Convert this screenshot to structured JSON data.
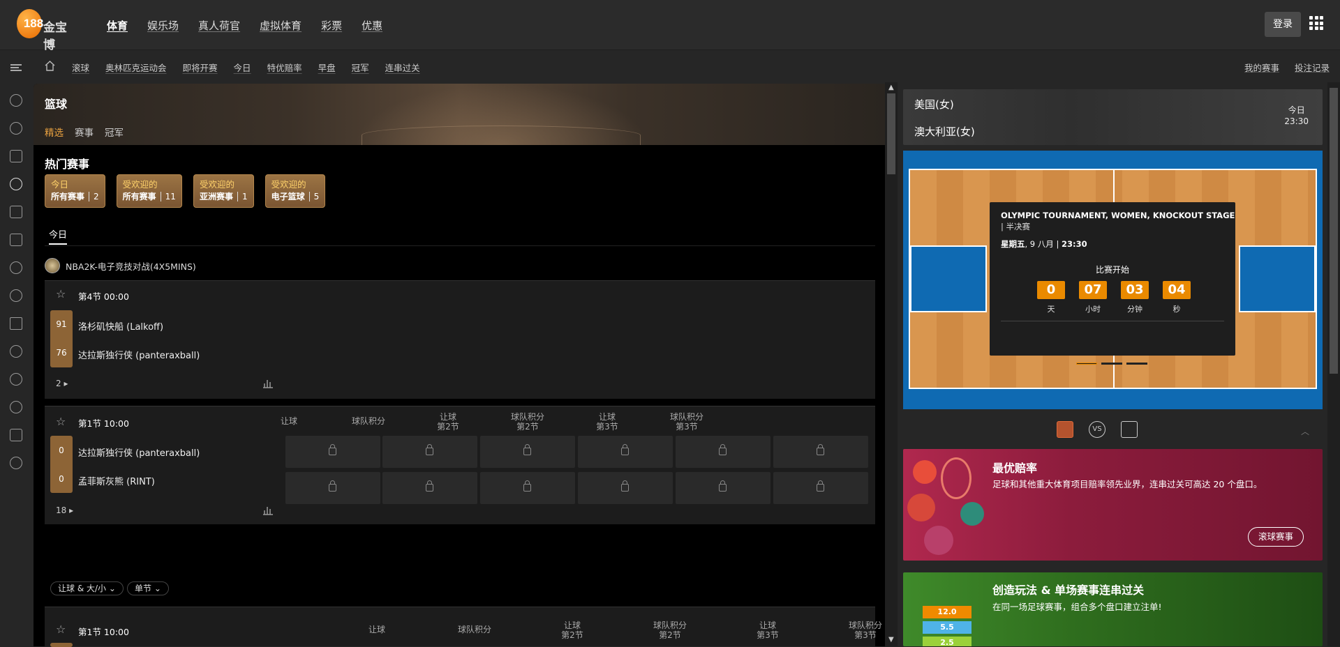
{
  "header": {
    "logo_text": "金宝博",
    "logo_mark": "188",
    "nav": [
      "体育",
      "娱乐场",
      "真人荷官",
      "虚拟体育",
      "彩票",
      "优惠"
    ],
    "login": "登录"
  },
  "subnav": {
    "items": [
      "滚球",
      "奥林匹克运动会",
      "即将开赛",
      "今日",
      "特优赔率",
      "早盘",
      "冠军",
      "连串过关"
    ],
    "my_events": "我的赛事",
    "bet_record": "投注记录"
  },
  "page": {
    "sport_title": "篮球",
    "tabs": [
      "精选",
      "赛事",
      "冠军"
    ],
    "hot_title": "热门赛事",
    "chips": [
      {
        "top": "今日",
        "bottom": "所有赛事",
        "count": "2"
      },
      {
        "top": "受欢迎的",
        "bottom": "所有赛事",
        "count": "11"
      },
      {
        "top": "受欢迎的",
        "bottom": "亚洲赛事",
        "count": "1"
      },
      {
        "top": "受欢迎的",
        "bottom": "电子篮球",
        "count": "5"
      }
    ],
    "today_tab": "今日",
    "league": "NBA2K-电子竞技对战(4X5MINS)"
  },
  "match1": {
    "period": "第4节 00:00",
    "home_score": "91",
    "home_team": "洛杉矶快船 (Lalkoff)",
    "away_score": "76",
    "away_team": "达拉斯独行侠 (panteraxball)",
    "more_count": "2"
  },
  "match2": {
    "period": "第1节 10:00",
    "home_score": "0",
    "home_team": "达拉斯独行侠 (panteraxball)",
    "away_score": "0",
    "away_team": "孟菲斯灰熊 (RINT)",
    "more_count": "18",
    "columns": [
      {
        "l1": "让球",
        "l2": ""
      },
      {
        "l1": "球队积分",
        "l2": ""
      },
      {
        "l1": "让球",
        "l2": "第2节"
      },
      {
        "l1": "球队积分",
        "l2": "第2节"
      },
      {
        "l1": "让球",
        "l2": "第3节"
      },
      {
        "l1": "球队积分",
        "l2": "第3节"
      }
    ]
  },
  "filters": {
    "market": "让球 & 大/小",
    "period": "单节"
  },
  "match3": {
    "period": "第1节 10:00"
  },
  "sidebar_match": {
    "team1": "美国(女)",
    "team2": "澳大利亚(女)",
    "day": "今日",
    "time": "23:30",
    "tournament": "OLYMPIC TOURNAMENT, WOMEN, KNOCKOUT STAGE",
    "stage": "| 半决赛",
    "date_bold": "星期五",
    "date_rest": ", 9 八月 | ",
    "time_bold": "23:30",
    "start_label": "比赛开始",
    "countdown": [
      {
        "value": "0",
        "label": "天"
      },
      {
        "value": "07",
        "label": "小时"
      },
      {
        "value": "03",
        "label": "分钟"
      },
      {
        "value": "04",
        "label": "秒"
      }
    ],
    "vs_label": "VS"
  },
  "promos": [
    {
      "title": "最优赔率",
      "desc": "足球和其他重大体育项目赔率领先业界，连串过关可高达 20 个盘口。",
      "button": "滚球赛事"
    },
    {
      "title": "创造玩法 & 单场赛事连串过关",
      "desc": "在同一场足球赛事，组合多个盘口建立注单!",
      "odds": [
        "12.0",
        "5.5",
        "2.5"
      ]
    }
  ],
  "colors": {
    "accent": "#e9a240",
    "chip": "#8d6436",
    "countdown": "#ea8a00",
    "promo_red": "#8c1c3c",
    "promo_green": "#2f6e1e"
  }
}
